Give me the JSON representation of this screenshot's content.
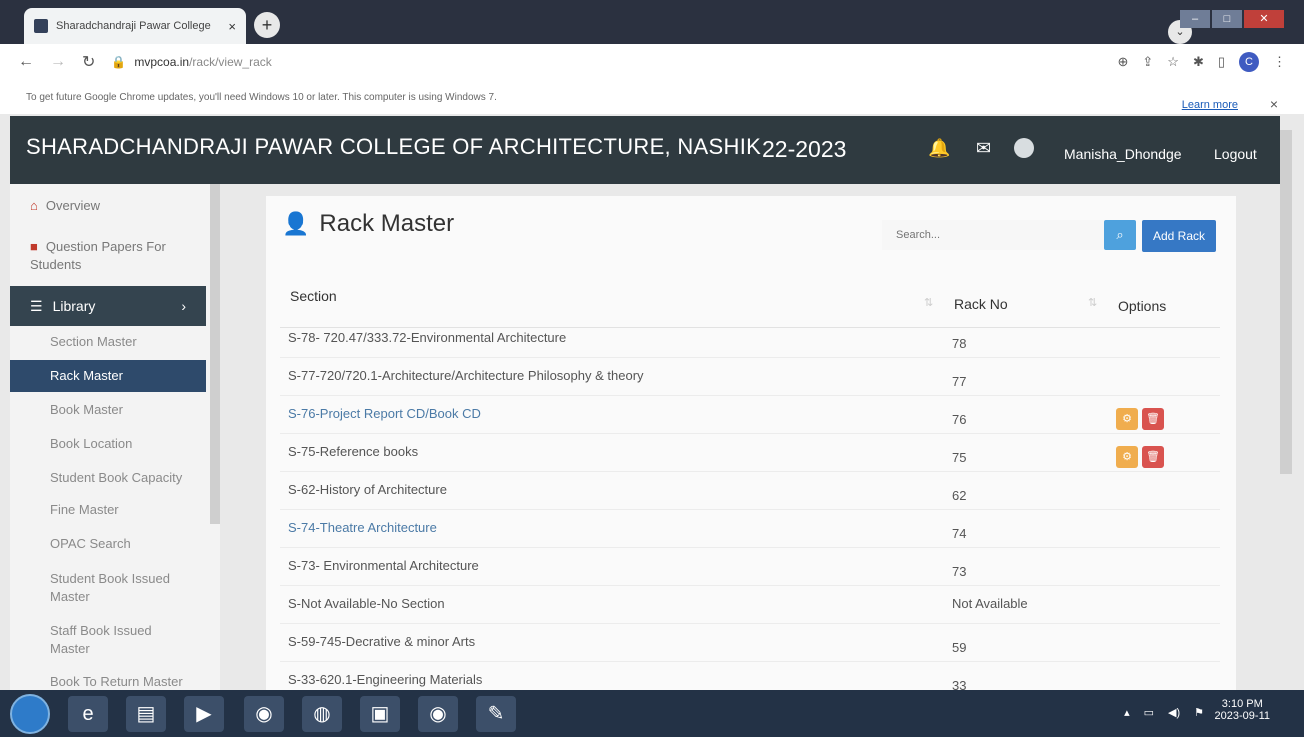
{
  "browser": {
    "tab_title": "Sharadchandraji Pawar College",
    "tab_close": "×",
    "new_tab": "+",
    "url_domain": "mvpcoa.in",
    "url_path": "/rack/view_rack",
    "profile_letter": "C"
  },
  "infobar": {
    "message": "To get future Google Chrome updates, you'll need Windows 10 or later. This computer is using Windows 7.",
    "learn_more": "Learn more",
    "close": "×"
  },
  "header": {
    "college_name": "SHARADCHANDRAJI PAWAR COLLEGE OF ARCHITECTURE, NASHIK",
    "academic_year": "22-2023",
    "username": "Manisha_Dhondge",
    "logout": "Logout"
  },
  "sidebar": {
    "overview": "Overview",
    "question_papers": "Question Papers For Students",
    "library": "Library",
    "sub_items": [
      "Section Master",
      "Rack Master",
      "Book Master",
      "Book Location",
      "Student Book Capacity",
      "Fine Master",
      "OPAC Search",
      "Student Book Issued Master",
      "Staff Book Issued Master",
      "Book To Return Master"
    ]
  },
  "page": {
    "title": "Rack Master",
    "search_placeholder": "Search...",
    "add_button": "Add Rack"
  },
  "table": {
    "headers": {
      "section": "Section",
      "rack_no": "Rack No",
      "options": "Options"
    },
    "rows": [
      {
        "section": "S-78- 720.47/333.72-Environmental Architecture",
        "rack": "78"
      },
      {
        "section": "S-77-720/720.1-Architecture/Architecture Philosophy & theory",
        "rack": "77"
      },
      {
        "section": "S-76-Project Report CD/Book CD",
        "rack": "76"
      },
      {
        "section": "S-75-Reference books",
        "rack": "75"
      },
      {
        "section": "S-62-History of Architecture",
        "rack": "62"
      },
      {
        "section": "S-74-Theatre Architecture",
        "rack": "74"
      },
      {
        "section": "S-73- Environmental Architecture",
        "rack": "73"
      },
      {
        "section": "S-Not Available-No Section",
        "rack": "Not Available"
      },
      {
        "section": "S-59-745-Decrative & minor Arts",
        "rack": "59"
      },
      {
        "section": "S-33-620.1-Engineering Materials",
        "rack": "33"
      }
    ]
  },
  "taskbar": {
    "time": "3:10 PM",
    "date": "2023-09-11"
  },
  "colors": {
    "header_bg": "#2f3a40",
    "sidebar_active": "#2e4a6b",
    "add_button": "#3678c5",
    "edit_button": "#f0ad4e",
    "delete_button": "#d9534f"
  }
}
